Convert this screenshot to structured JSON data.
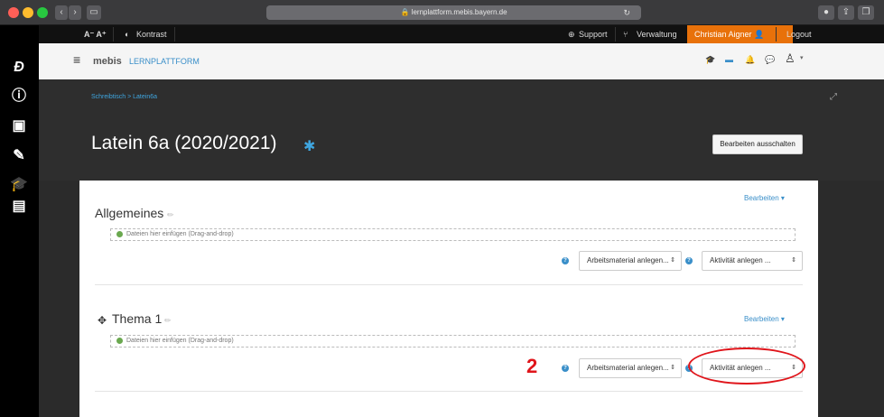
{
  "browser": {
    "url": "lernplattform.mebis.bayern.de",
    "reload_glyph": "↻"
  },
  "topbar": {
    "font_size_label": "A⁻ A⁺",
    "contrast_label": "Kontrast",
    "support_label": "Support",
    "verwaltung_label": "Verwaltung",
    "user_name": "Christian Aigner",
    "logout_label": "Logout"
  },
  "header": {
    "menu_glyph": "≡",
    "brand_name": "mebis",
    "brand_suffix": "LERNPLATTFORM"
  },
  "breadcrumb": {
    "items": [
      "Schreibtisch",
      ">",
      "Latein6a"
    ]
  },
  "course": {
    "title": "Latein 6a (2020/2021)",
    "edit_off_label": "Bearbeiten ausschalten"
  },
  "sections": [
    {
      "title": "Allgemeines",
      "edit_label": "Bearbeiten",
      "dropzone_text": "Dateien hier einfügen (Drag-and-drop)",
      "resource_select": "Arbeitsmaterial anlegen...",
      "activity_select": "Aktivität anlegen ..."
    },
    {
      "title": "Thema 1",
      "edit_label": "Bearbeiten",
      "dropzone_text": "Dateien hier einfügen (Drag-and-drop)",
      "resource_select": "Arbeitsmaterial anlegen...",
      "activity_select": "Aktivität anlegen ..."
    }
  ],
  "annotation": {
    "number": "2"
  },
  "colors": {
    "accent_orange": "#e8710a",
    "link_blue": "#3a8fc9",
    "annotation_red": "#e0151b"
  }
}
